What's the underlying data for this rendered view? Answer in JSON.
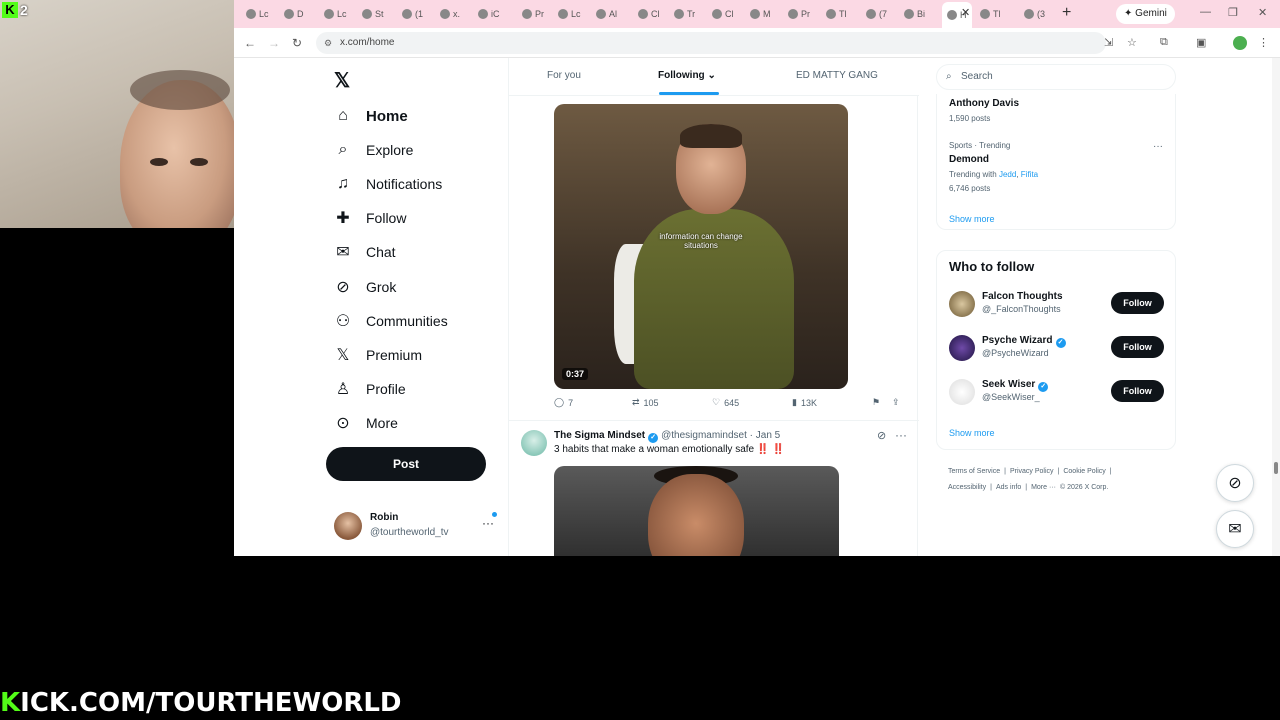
{
  "overlay": {
    "badge_count": "2",
    "kick_prefix": "K",
    "kick_text": "ICK.COM/TOURTHEWORLD"
  },
  "browser": {
    "tabs": [
      "Lc",
      "D",
      "Lc",
      "St",
      "(1",
      "x.",
      "iC",
      "Pr",
      "Lc",
      "Al",
      "Cl",
      "Tr",
      "Cl",
      "M",
      "Pr",
      "Tl",
      "(7",
      "Bi",
      "H",
      "Tl",
      "(3"
    ],
    "gemini_label": "Gemini",
    "url": "x.com/home"
  },
  "nav": {
    "items": [
      {
        "label": "Home",
        "icon": "home-icon"
      },
      {
        "label": "Explore",
        "icon": "search-icon"
      },
      {
        "label": "Notifications",
        "icon": "bell-icon"
      },
      {
        "label": "Follow",
        "icon": "add-user-icon"
      },
      {
        "label": "Chat",
        "icon": "mail-icon"
      },
      {
        "label": "Grok",
        "icon": "grok-icon"
      },
      {
        "label": "Communities",
        "icon": "communities-icon"
      },
      {
        "label": "Premium",
        "icon": "x-logo-icon"
      },
      {
        "label": "Profile",
        "icon": "person-icon"
      },
      {
        "label": "More",
        "icon": "more-circle-icon"
      }
    ],
    "post_label": "Post",
    "user_name": "Robin",
    "user_handle": "@tourtheworld_tv"
  },
  "feed": {
    "tabs": [
      "For you",
      "Following",
      "ED MATTY GANG"
    ],
    "active_tab": "Following",
    "video1": {
      "caption_line1": "information can change",
      "caption_line2": "situations",
      "duration": "0:37"
    },
    "actions": {
      "replies": "7",
      "reposts": "105",
      "likes": "645",
      "views": "13K"
    },
    "tweet2": {
      "name": "The Sigma Mindset",
      "handle": "@thesigmamindset",
      "date": "· Jan 5",
      "text": "3 habits that make a woman emotionally safe",
      "emoji": "‼️ ‼️"
    }
  },
  "right": {
    "search_placeholder": "Search",
    "trend1": {
      "title": "Anthony Davis",
      "posts": "1,590 posts"
    },
    "trend2": {
      "category": "Sports · Trending",
      "title": "Demond",
      "trending_with_label": "Trending with",
      "link1": "Jedd",
      "link2": "Fifita",
      "posts": "6,746 posts"
    },
    "show_more": "Show more",
    "who_to_follow_title": "Who to follow",
    "follow_suggestions": [
      {
        "name": "Falcon Thoughts",
        "handle": "@_FalconThoughts",
        "verified": false,
        "button": "Follow"
      },
      {
        "name": "Psyche Wizard",
        "handle": "@PsycheWizard",
        "verified": true,
        "button": "Follow"
      },
      {
        "name": "Seek Wiser",
        "handle": "@SeekWiser_",
        "verified": true,
        "button": "Follow"
      }
    ],
    "show_more_2": "Show more",
    "footer": [
      "Terms of Service",
      "|",
      "Privacy Policy",
      "|",
      "Cookie Policy",
      "|",
      "Accessibility",
      "|",
      "Ads info",
      "|",
      "More ···",
      "© 2026 X Corp."
    ]
  },
  "colors": {
    "accent": "#1d9bf0",
    "text_primary": "#0f1419",
    "text_secondary": "#536471",
    "tabstrip": "#fbd9e4",
    "kick_green": "#53fc18"
  }
}
